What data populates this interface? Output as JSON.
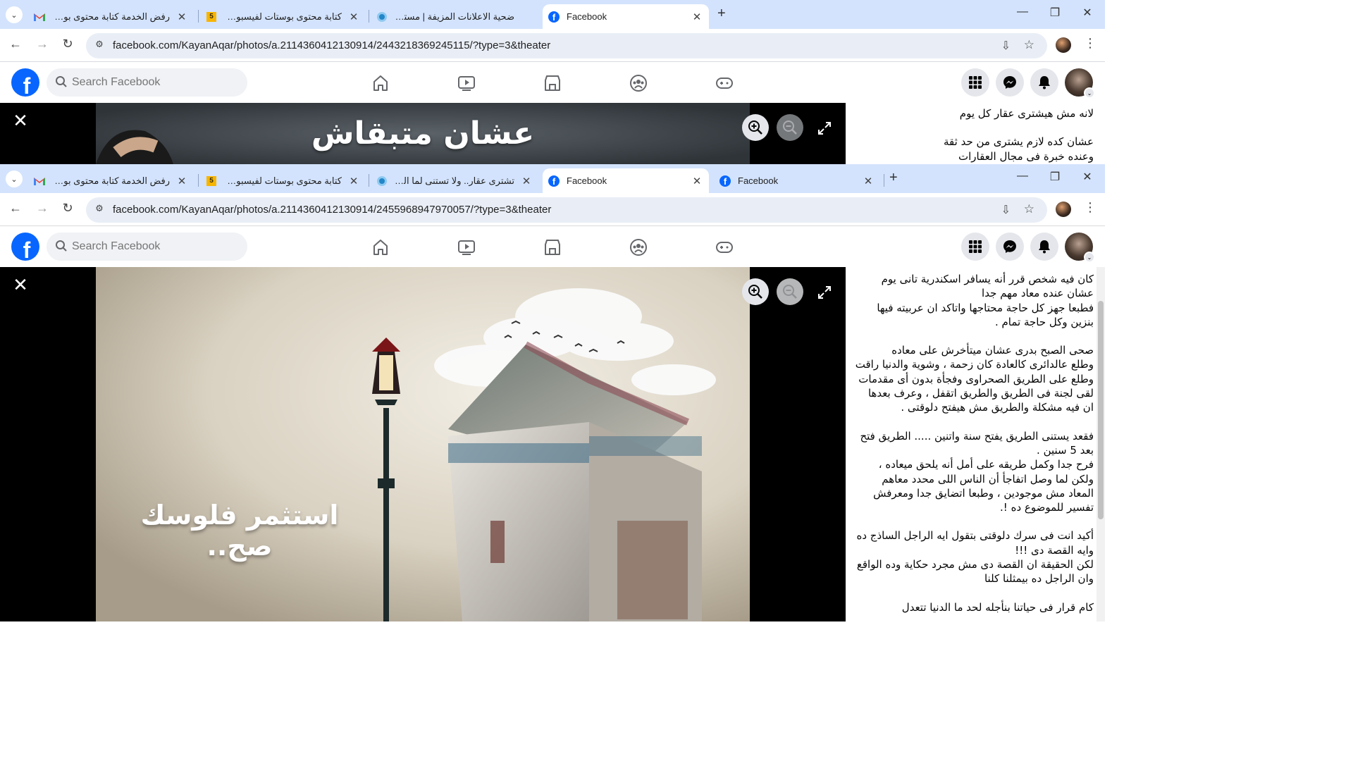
{
  "window1": {
    "tabs": [
      {
        "title": "رفض الخدمة كتابة محتوى بوستات",
        "icon": "gmail-icon"
      },
      {
        "title": "كتابة محتوى بوستات لفيسبوك - ...",
        "icon": "khamsat-icon"
      },
      {
        "title": "ضحية الاعلانات المزيفة | مستقل",
        "icon": "mostaql-icon"
      },
      {
        "title": "Facebook",
        "icon": "facebook-icon",
        "active": true
      }
    ],
    "url": "facebook.com/KayanAqar/photos/a.2114360412130914/2443218369245115/?type=3&theater",
    "photo_headline": "عشان متبقاش",
    "post_lines": [
      "لانه مش هيشترى عقار كل يوم",
      "",
      "عشان كده لازم يشترى من حد ثقة",
      "وعنده خبرة فى مجال العقارات"
    ]
  },
  "window2": {
    "tabs": [
      {
        "title": "رفض الخدمة كتابة محتوى بوستات",
        "icon": "gmail-icon"
      },
      {
        "title": "كتابة محتوى بوستات لفيسبوك - ...",
        "icon": "khamsat-icon"
      },
      {
        "title": "تشترى عقار.. ولا تستنى لما الظرو...",
        "icon": "mostaql-icon"
      },
      {
        "title": "Facebook",
        "icon": "facebook-icon",
        "active": true
      },
      {
        "title": "Facebook",
        "icon": "facebook-icon"
      }
    ],
    "url": "facebook.com/KayanAqar/photos/a.2114360412130914/2455968947970057/?type=3&theater",
    "photo_headline": "استثمر فلوسك صح..",
    "post_lines": [
      "كان فيه شخص قرر أنه يسافر اسكندرية تانى يوم",
      "عشان عنده معاد مهم جدا",
      "فطبعا جهز كل حاجة محتاجها واتاكد ان عربيته فيها",
      "بنزين وكل حاجة تمام .",
      "",
      "صحى الصبح بدرى عشان ميتأخرش على معاده",
      "وطلع عالدائرى كالعادة كان زحمة ، وشوية والدنيا راقت",
      "وطلع على الطريق الصحراوى وفجأة بدون أى مقدمات",
      "لقى لجنة فى الطريق والطريق اتقفل ، وعرف بعدها",
      "ان فيه مشكلة والطريق مش هيفتح دلوقتى .",
      "",
      "فقعد يستنى الطريق يفتح سنة واتنين ..... الطريق فتح",
      "بعد 5 سنين .",
      "فرح جدا وكمل طريقه على أمل أنه يلحق ميعاده ،",
      "ولكن لما وصل اتفاجأ أن الناس اللى محدد معاهم",
      "المعاد مش موجودين ، وطبعا اتضايق جدا ومعرفش",
      "تفسير للموضوع ده !.",
      "",
      "أكيد انت فى سرك دلوقتى بتقول ايه الراجل الساذج ده",
      "وايه القصة دى !!!",
      "لكن الحقيقة ان القصة دى مش مجرد حكاية وده الواقع",
      "وان الراجل ده بيمثلنا كلنا",
      "",
      "كام قرار فى حياتنا بنأجله لحد ما الدنيا تتعدل"
    ]
  },
  "fb": {
    "search_placeholder": "Search Facebook",
    "logo_letter": "f"
  },
  "colors": {
    "tabstrip": "#d3e3fd",
    "facebook_blue": "#0866ff",
    "viewer_bg": "#000000"
  }
}
